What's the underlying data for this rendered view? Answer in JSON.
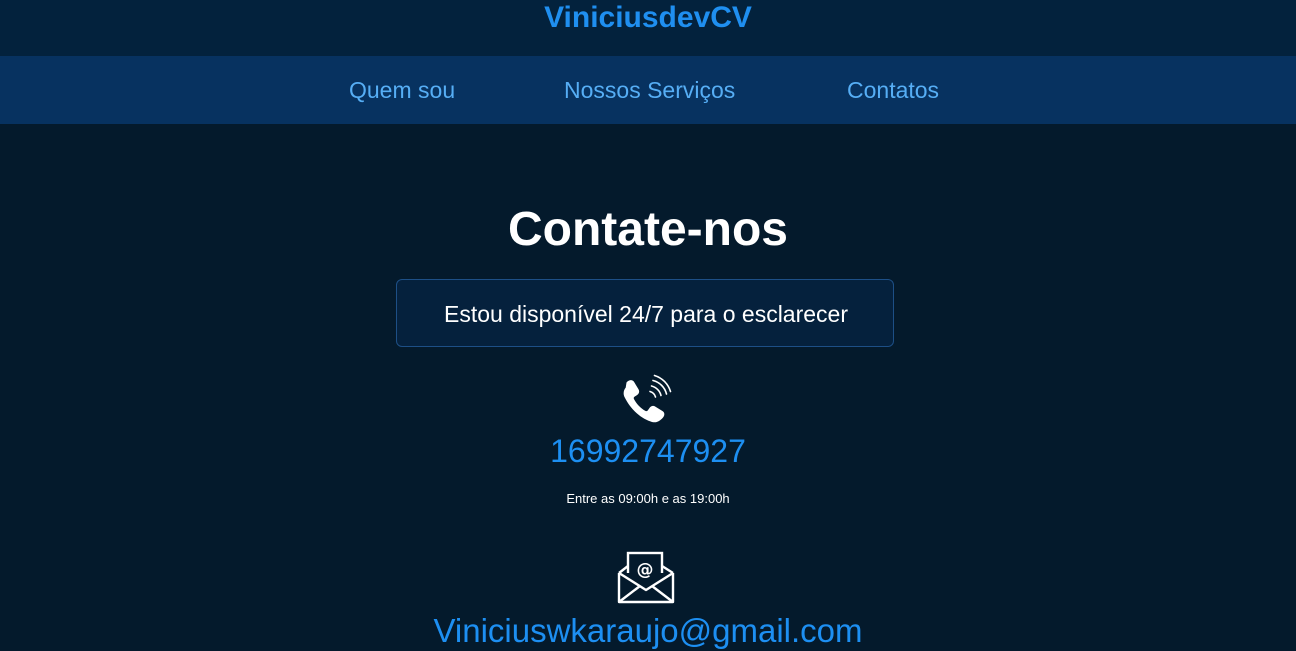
{
  "header": {
    "brand": "ViniciusdevCV"
  },
  "nav": {
    "items": [
      {
        "label": "Quem sou"
      },
      {
        "label": "Nossos Serviços"
      },
      {
        "label": "Contatos"
      }
    ]
  },
  "contact": {
    "title": "Contate-nos",
    "availability": "Estou disponível 24/7 para o esclarecer",
    "phone_icon": "phone-ringing-icon",
    "phone": "16992747927",
    "hours": "Entre as 09:00h e as 19:00h",
    "email_icon": "envelope-at-icon",
    "email": "Viniciuswkaraujo@gmail.com"
  },
  "colors": {
    "page_background": "#041a2c",
    "header_background": "#03223d",
    "nav_background": "#073260",
    "brand": "#1f8ff0",
    "nav_link": "#56aef5",
    "accent_link": "#1d8ff2",
    "text": "#ffffff"
  }
}
